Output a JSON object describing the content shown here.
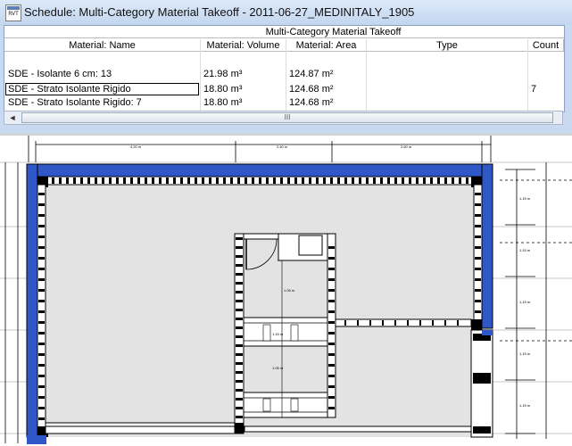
{
  "window": {
    "icon_label": "RVT",
    "title": "Schedule: Multi-Category Material Takeoff - 2011-06-27_MEDINITALY_1905"
  },
  "schedule": {
    "title": "Multi-Category Material Takeoff",
    "columns": [
      "Material: Name",
      "Material: Volume",
      "Material: Area",
      "Type",
      "Count"
    ],
    "rows": [
      {
        "name": "SDE - Isolante 6 cm: 13",
        "volume": "21.98 m³",
        "area": "124.87 m²",
        "type": "",
        "count": ""
      },
      {
        "name": "SDE - Strato Isolante Rigido",
        "volume": "18.80 m³",
        "area": "124.68 m²",
        "type": "",
        "count": "7"
      },
      {
        "name": "SDE - Strato Isolante Rigido: 7",
        "volume": "18.80 m³",
        "area": "124.68 m²",
        "type": "",
        "count": ""
      }
    ]
  },
  "scrollbar": {
    "left_arrow": "◄",
    "thumb_grip": "III"
  },
  "plan": {
    "top_dimensions": [
      "4.20 m",
      "2.40 m",
      "2.60 m"
    ],
    "right_dimensions": [
      "1.15 m",
      "1.15 m",
      "1.15 m",
      "1.15 m",
      "1.15 m"
    ],
    "inner_dimensions": [
      "1.05 m",
      "1.15 m",
      "1.05 m"
    ],
    "colors": {
      "insulation": "#2f57c8",
      "wall_fill": "#ffffff",
      "floor": "#e3e3e3",
      "line": "#000000"
    }
  }
}
